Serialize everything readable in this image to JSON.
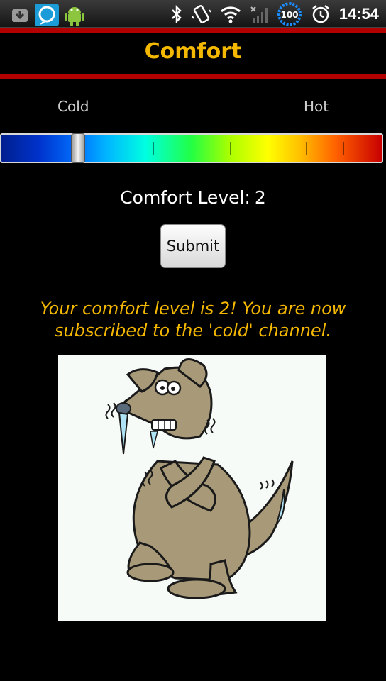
{
  "status_bar": {
    "icons_left": [
      "download-icon",
      "chat-bubble-icon",
      "android-robot-icon"
    ],
    "icons_right": [
      "bluetooth-icon",
      "vibrate-icon",
      "wifi-icon",
      "signal-icon",
      "battery-icon",
      "alarm-clock-icon"
    ],
    "battery_level": "100",
    "time": "14:54"
  },
  "header": {
    "title": "Comfort"
  },
  "slider": {
    "min_label": "Cold",
    "max_label": "Hot",
    "value": 2,
    "min": 0,
    "max": 10
  },
  "comfort": {
    "level_label": "Comfort Level:",
    "level_value": "2"
  },
  "submit": {
    "label": "Submit"
  },
  "result": {
    "message": "Your comfort level is 2! You are now subscribed to the 'cold' channel."
  },
  "image": {
    "subject": "shivering-cold-dog"
  },
  "colors": {
    "accent": "#f5b800",
    "divider": "#b30000",
    "background": "#000000"
  }
}
